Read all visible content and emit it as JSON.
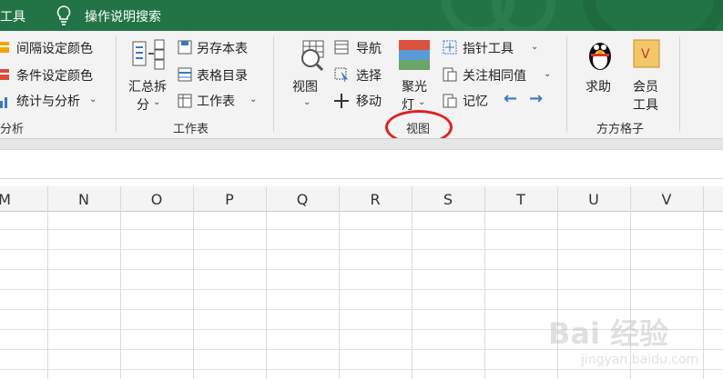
{
  "titlebar": {
    "tools_label": "工具",
    "help_search": "操作说明搜索",
    "bg_color": "#227447"
  },
  "ribbon": {
    "analysis_group": {
      "items": [
        "间隔设定颜色",
        "条件设定颜色",
        "统计与分析"
      ],
      "group_label": "分析"
    },
    "worksheet_group": {
      "summary_split_label": "汇总拆",
      "summary_split_label2": "分",
      "items": [
        "另存本表",
        "表格目录",
        "工作表"
      ],
      "group_label": "工作表"
    },
    "view_group": {
      "view_label": "视图",
      "items": [
        "导航",
        "选择",
        "移动"
      ],
      "spotlight_label": "聚光",
      "spotlight_label2": "灯",
      "items2": [
        "指针工具",
        "关注相同值",
        "记忆"
      ],
      "group_label": "视图"
    },
    "fangfang_group": {
      "help_label": "求助",
      "member_label": "会员",
      "member_label2": "工具",
      "group_label": "方方格子"
    }
  },
  "columns": [
    "M",
    "N",
    "O",
    "P",
    "Q",
    "R",
    "S",
    "T",
    "U",
    "V"
  ],
  "watermark": {
    "text": "Bai 经验",
    "url": "jingyan.baidu.com"
  },
  "colors": {
    "accent_green": "#227447",
    "annotation_circle": "#e02020"
  }
}
